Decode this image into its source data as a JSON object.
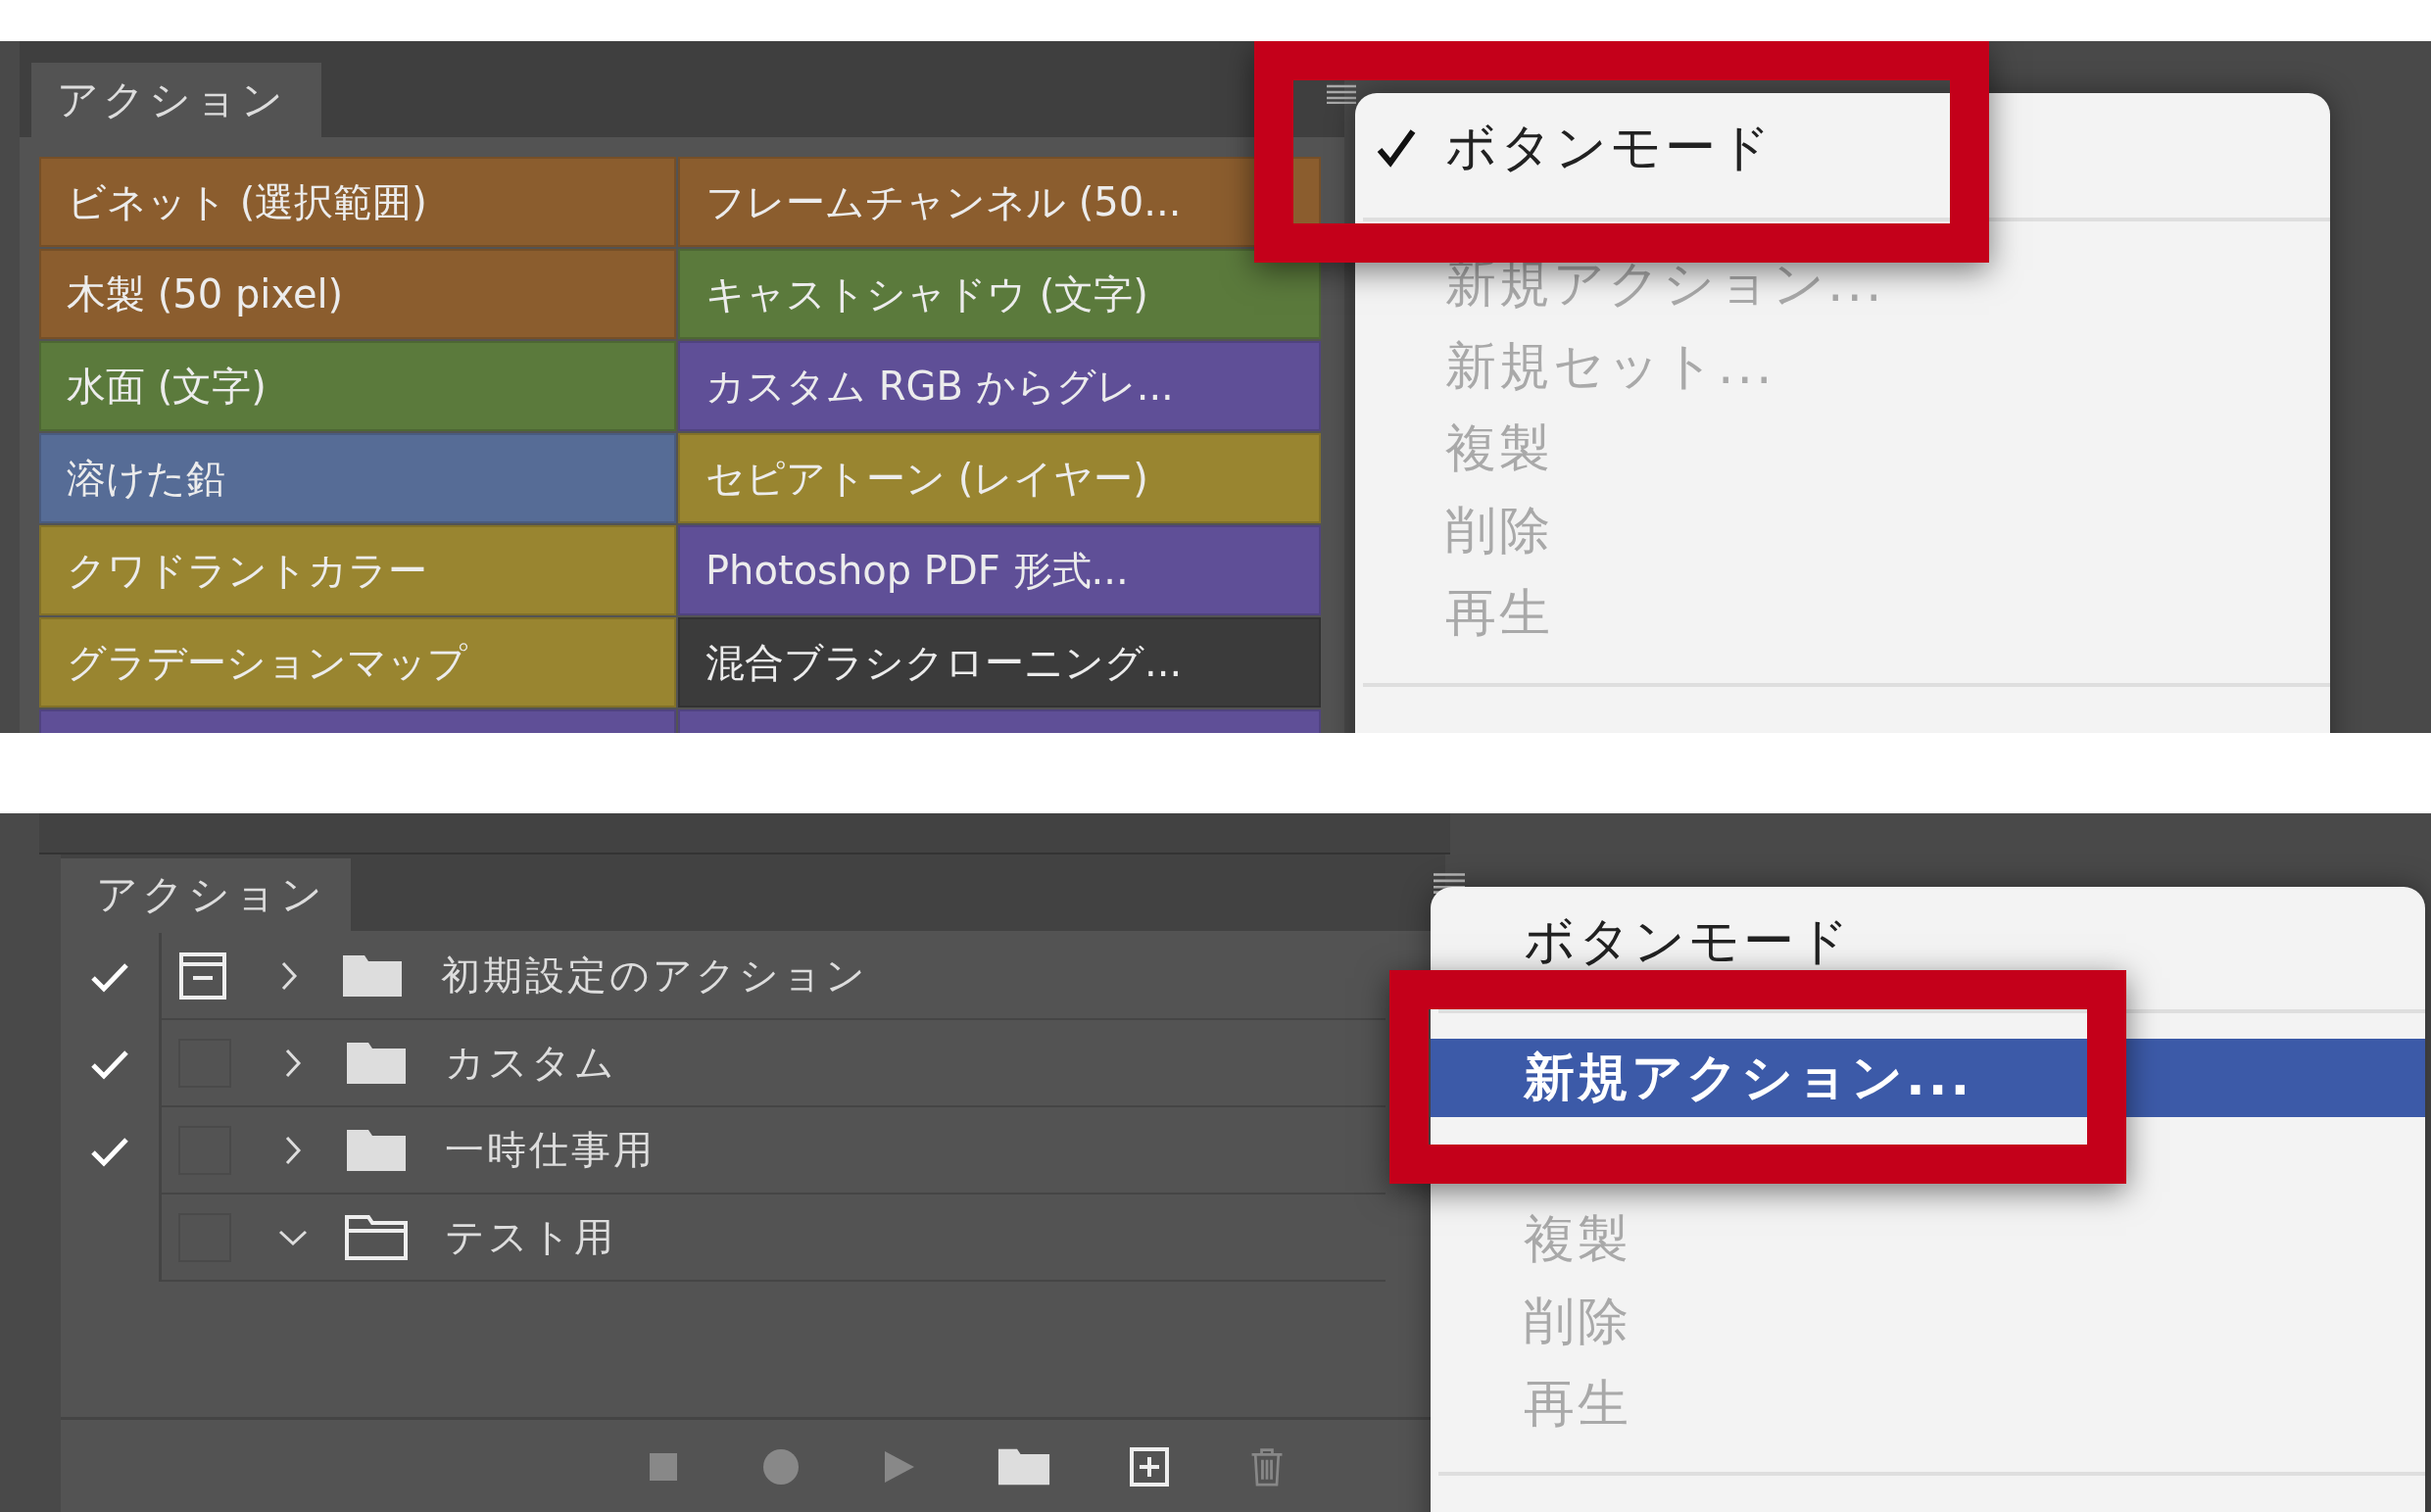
{
  "screens": [
    {
      "kind": "button_mode",
      "panel": {
        "tab": "アクション",
        "buttons": [
          {
            "label": "ビネット (選択範囲)",
            "color": "#8b5d2e"
          },
          {
            "label": "フレームチャンネル (50...",
            "color": "#8b5d2e"
          },
          {
            "label": "木製 (50 pixel)",
            "color": "#8b5d2e"
          },
          {
            "label": "キャストシャドウ (文字)",
            "color": "#5b7a3c"
          },
          {
            "label": "水面 (文字)",
            "color": "#5b7a3c"
          },
          {
            "label": "カスタム RGB からグレ...",
            "color": "#5f4f97"
          },
          {
            "label": "溶けた鉛",
            "color": "#566c96"
          },
          {
            "label": "セピアトーン (レイヤー)",
            "color": "#998530"
          },
          {
            "label": "クワドラントカラー",
            "color": "#998530"
          },
          {
            "label": "Photoshop PDF 形式...",
            "color": "#5f4f97"
          },
          {
            "label": "グラデーションマップ",
            "color": "#998530"
          },
          {
            "label": "混合ブラシクローニング...",
            "color": "#3b3b3b"
          },
          {
            "color": "#5f4f97"
          },
          {
            "color": "#5f4f97"
          }
        ]
      },
      "menu": {
        "items": [
          {
            "label": "ボタンモード",
            "checked": true,
            "disabled": false,
            "selected": false
          },
          {
            "kind": "separator"
          },
          {
            "label": "新規アクション...",
            "checked": false,
            "disabled": true,
            "selected": false
          },
          {
            "label": "新規セット...",
            "checked": false,
            "disabled": true,
            "selected": false
          },
          {
            "label": "複製",
            "checked": false,
            "disabled": true,
            "selected": false
          },
          {
            "label": "削除",
            "checked": false,
            "disabled": true,
            "selected": false
          },
          {
            "label": "再生",
            "checked": false,
            "disabled": true,
            "selected": false
          },
          {
            "kind": "separator"
          }
        ]
      }
    },
    {
      "kind": "list_mode",
      "panel": {
        "tab": "アクション",
        "sets": [
          {
            "name": "初期設定のアクション",
            "enabled": true,
            "dialog": true,
            "expanded": false
          },
          {
            "name": "カスタム",
            "enabled": true,
            "dialog": false,
            "expanded": false
          },
          {
            "name": "一時仕事用",
            "enabled": true,
            "dialog": false,
            "expanded": false
          },
          {
            "name": "テスト用",
            "enabled": false,
            "dialog": false,
            "expanded": true
          }
        ]
      },
      "menu": {
        "items": [
          {
            "label": "ボタンモード",
            "checked": false,
            "disabled": false,
            "selected": false
          },
          {
            "kind": "separator"
          },
          {
            "label": "新規アクション...",
            "checked": false,
            "disabled": false,
            "selected": true
          },
          {
            "kind": "gap"
          },
          {
            "label": "複製",
            "checked": false,
            "disabled": true,
            "selected": false
          },
          {
            "label": "削除",
            "checked": false,
            "disabled": true,
            "selected": false
          },
          {
            "label": "再生",
            "checked": false,
            "disabled": true,
            "selected": false
          },
          {
            "kind": "separator"
          }
        ]
      }
    }
  ]
}
